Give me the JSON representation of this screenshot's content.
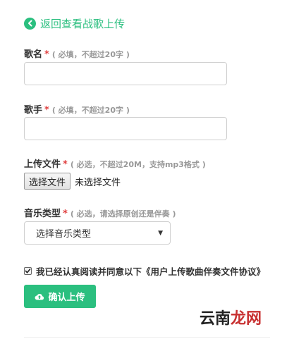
{
  "back": {
    "label": "返回查看战歌上传"
  },
  "fields": {
    "song_name": {
      "label": "歌名",
      "required": "*",
      "hint": "( 必填，不超过20字 )",
      "value": ""
    },
    "singer": {
      "label": "歌手",
      "required": "*",
      "hint": "( 必填，不超过20字 )",
      "value": ""
    },
    "upload_file": {
      "label": "上传文件",
      "required": "*",
      "hint": "( 必选，不超过20M，支持mp3格式 )",
      "button": "选择文件",
      "status": "未选择文件"
    },
    "music_type": {
      "label": "音乐类型",
      "required": "*",
      "hint": "( 必选，请选择原创还是伴奏 )",
      "selected": "选择音乐类型"
    }
  },
  "agreement": {
    "text": "我已经认真阅读并同意以下《用户上传歌曲伴奏文件协议》",
    "checked": true
  },
  "submit": {
    "label": "确认上传"
  },
  "watermark": {
    "part1": "云南",
    "part2": "龙网"
  },
  "colors": {
    "accent": "#2bbf7f",
    "required": "#e04040",
    "hint": "#999999"
  }
}
